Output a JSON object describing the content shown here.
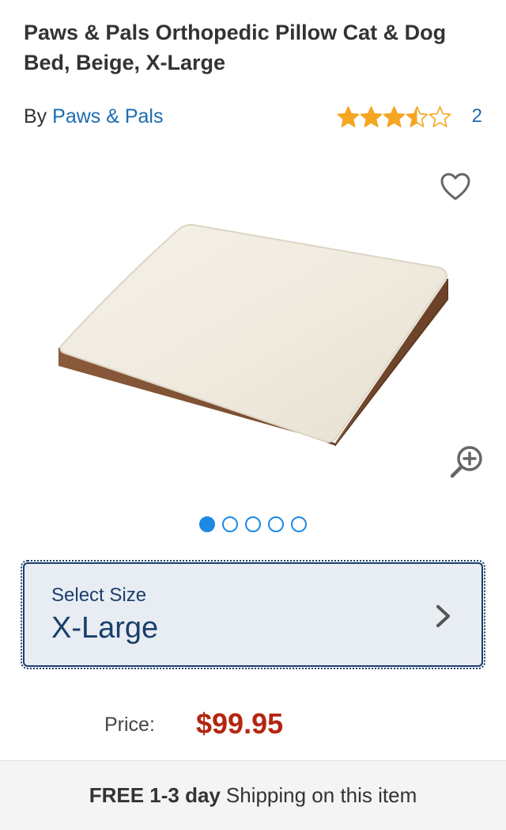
{
  "product": {
    "title": "Paws & Pals Orthopedic Pillow Cat & Dog Bed, Beige, X-Large",
    "by_prefix": "By",
    "brand": "Paws & Pals",
    "rating": 3.5,
    "rating_max": 5,
    "review_count": "2"
  },
  "gallery": {
    "image_count": 5,
    "active_index": 0,
    "favorite_icon": "heart-outline-icon",
    "zoom_icon": "zoom-in-icon"
  },
  "size_selector": {
    "label": "Select Size",
    "value": "X-Large",
    "icon": "chevron-right-icon"
  },
  "price": {
    "label": "Price:",
    "value": "$99.95"
  },
  "shipping": {
    "bold_text": "FREE 1-3 day",
    "text": "Shipping on this item"
  },
  "colors": {
    "link": "#1c6cb0",
    "star": "#f5a623",
    "price": "#b3260f",
    "selector_border": "#1a3e6b",
    "dot_active": "#1e88e5"
  }
}
